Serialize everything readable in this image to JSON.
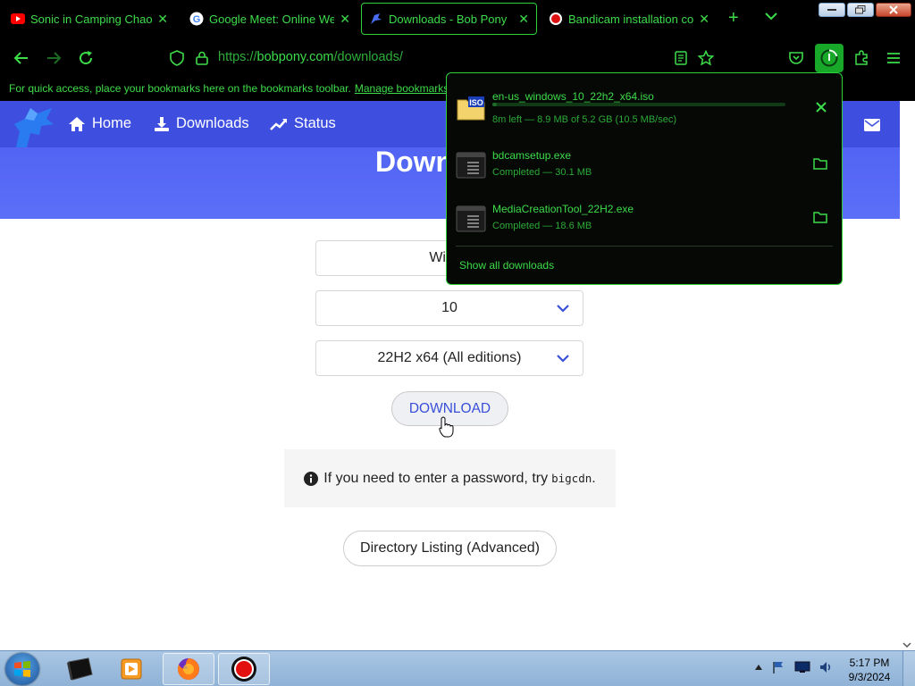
{
  "tabs": [
    {
      "title": "Sonic in Camping Chaos -",
      "icon": "youtube-icon"
    },
    {
      "title": "Google Meet: Online Web",
      "icon": "google-icon"
    },
    {
      "title": "Downloads - Bob Pony",
      "icon": "bobpony-icon",
      "active": true
    },
    {
      "title": "Bandicam installation con",
      "icon": "bandicam-icon"
    }
  ],
  "address": {
    "scheme": "https://",
    "host": "bobpony.com",
    "path": "/downloads/"
  },
  "bookmarks_bar": {
    "text": "For quick access, place your bookmarks here on the bookmarks toolbar.",
    "link": "Manage bookmarks..."
  },
  "site": {
    "nav": [
      {
        "label": "Home",
        "icon": "home-icon"
      },
      {
        "label": "Downloads",
        "icon": "download-icon"
      },
      {
        "label": "Status",
        "icon": "chart-line-icon"
      }
    ],
    "hero_title": "Down",
    "selects": {
      "os": "Windo",
      "version": "10",
      "build": "22H2 x64 (All editions)"
    },
    "download_button": "DOWNLOAD",
    "info": {
      "text": "If you need to enter a password, try",
      "code": "bigcdn",
      "end": "."
    },
    "directory_button": "Directory Listing (Advanced)"
  },
  "downloads_panel": {
    "items": [
      {
        "name": "en-us_windows_10_22h2_x64.iso",
        "status": "8m left — 8.9 MB of 5.2 GB (10.5 MB/sec)",
        "progress": 0.002,
        "icon": "iso-file-icon",
        "action": "cancel"
      },
      {
        "name": "bdcamsetup.exe",
        "status": "Completed — 30.1 MB",
        "icon": "exe-file-icon",
        "action": "open-folder"
      },
      {
        "name": "MediaCreationTool_22H2.exe",
        "status": "Completed — 18.6 MB",
        "icon": "exe-file-icon",
        "action": "open-folder"
      }
    ],
    "show_all": "Show all downloads"
  },
  "taskbar": {
    "time": "5:17 PM",
    "date": "9/3/2024",
    "items": [
      "start-orb",
      "terminal-app",
      "media-player-app",
      "firefox-app",
      "bandicam-app"
    ]
  },
  "colors": {
    "accent": "#3ddc4a",
    "site_header": "#4a5cf0",
    "chrome_bg": "#000000"
  }
}
